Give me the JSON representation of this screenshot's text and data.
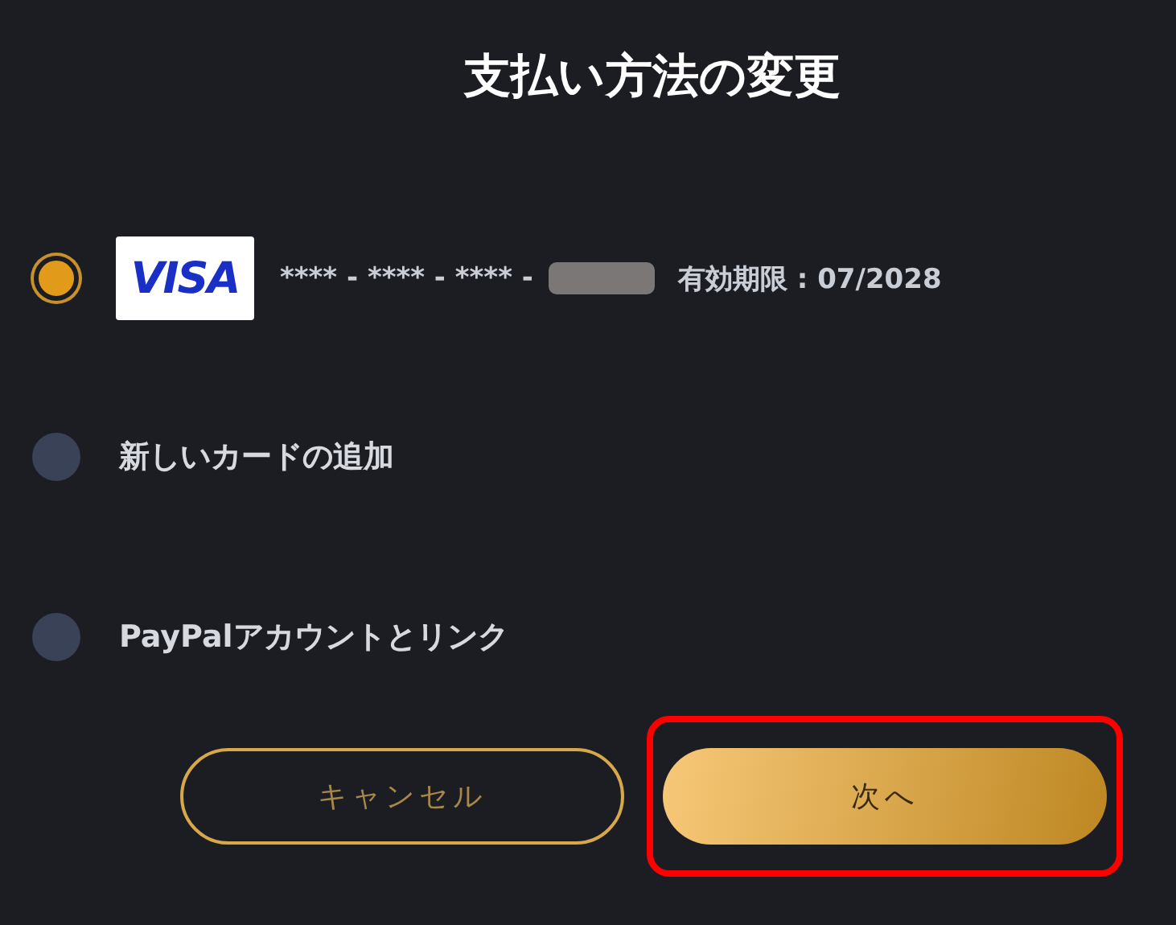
{
  "title": "支払い方法の変更",
  "options": [
    {
      "kind": "card",
      "selected": true,
      "card_number": "**** - **** - **** -",
      "redacted": true,
      "expiry": "有効期限 : 07/2028",
      "brand": "VISA"
    },
    {
      "kind": "text",
      "selected": false,
      "label": "新しいカードの追加"
    },
    {
      "kind": "text",
      "selected": false,
      "label": "PayPalアカウントとリンク"
    }
  ],
  "buttons": [
    {
      "label": "キャンセル",
      "kind": "outline",
      "highlighted": false
    },
    {
      "label": "次へ",
      "kind": "filled",
      "highlighted": true
    }
  ]
}
